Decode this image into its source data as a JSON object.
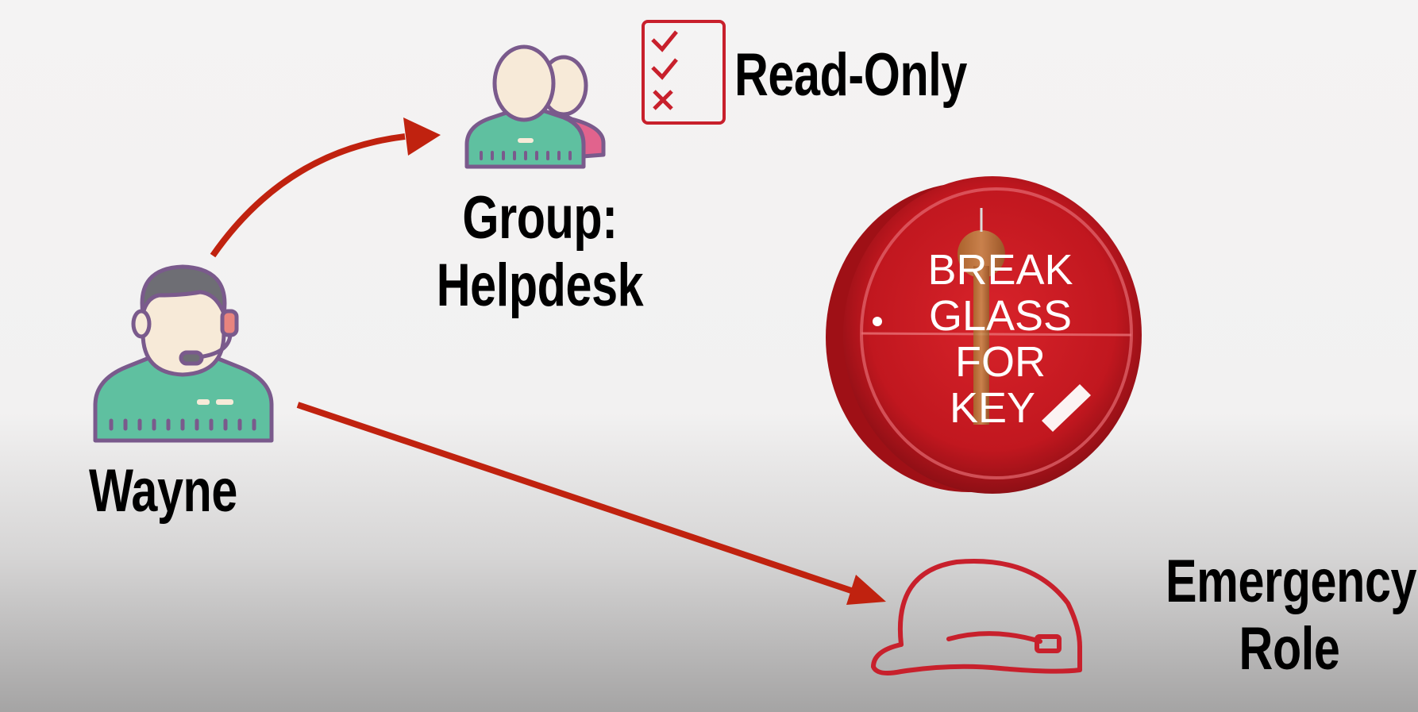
{
  "diagram": {
    "user": {
      "name": "Wayne",
      "icon": "headset-user-icon"
    },
    "group": {
      "line1": "Group:",
      "line2": "Helpdesk",
      "icon": "user-group-icon"
    },
    "permission": {
      "label": "Read-Only",
      "icon": "checklist-icon"
    },
    "break_glass": {
      "line1": "BREAK",
      "line2": "GLASS",
      "line3": "FOR",
      "line4": "KEY",
      "icon": "break-glass-key-box"
    },
    "role": {
      "line1": "Emergency",
      "line2": "Role",
      "icon": "hard-hat-icon"
    },
    "colors": {
      "arrow": "#c0220f",
      "accent_red": "#c8202c",
      "green": "#5fc0a0",
      "outline_purple": "#7a5a8c"
    }
  }
}
